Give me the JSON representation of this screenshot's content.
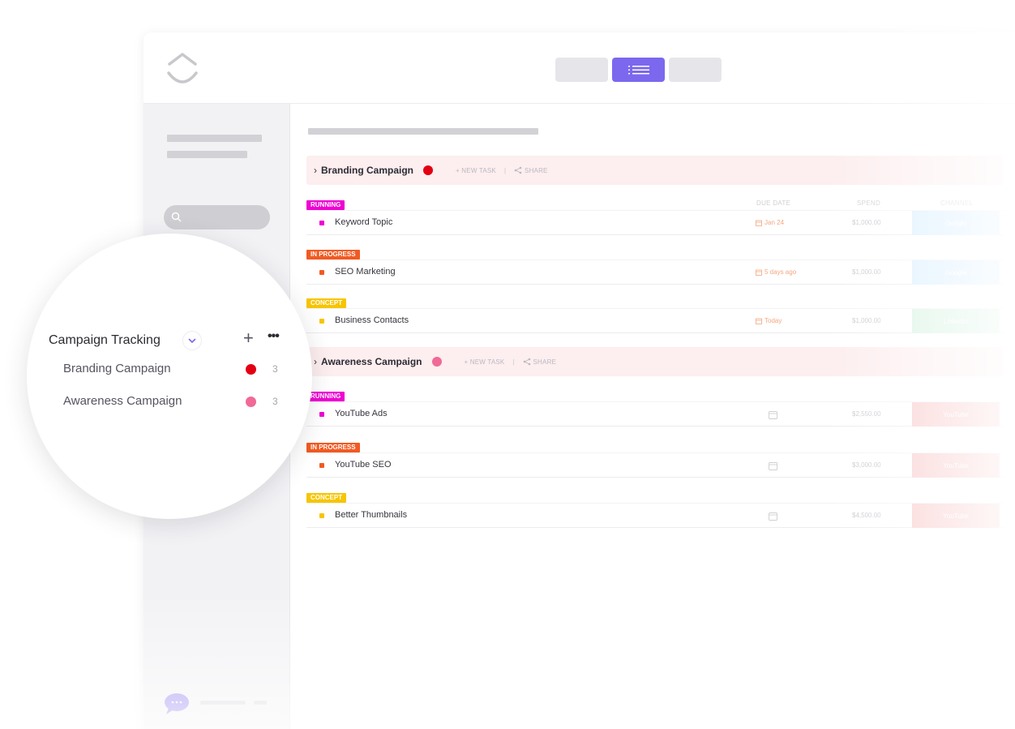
{
  "colors": {
    "accent": "#7b68ee",
    "running": "#ef00d3",
    "in_progress": "#f15a22",
    "concept": "#f7c500",
    "branding_dot": "#e20011",
    "awareness_dot": "#f06997",
    "google": "#d9efff",
    "linkedin": "#d7f3e2",
    "youtube": "#f9c9c9"
  },
  "columns": {
    "due_date": "DUE DATE",
    "spend": "SPEND",
    "channel": "CHANNEL"
  },
  "groups": [
    {
      "name": "Branding Campaign",
      "new_task": "+ NEW TASK",
      "separator": "|",
      "share": "SHARE",
      "tasks": [
        {
          "status": "RUNNING",
          "name": "Keyword Topic",
          "due": "Jan 24",
          "spend": "$1,000.00",
          "channel": "Google"
        },
        {
          "status": "IN PROGRESS",
          "name": "SEO Marketing",
          "due": "5 days ago",
          "spend": "$1,000.00",
          "channel": "Google"
        },
        {
          "status": "CONCEPT",
          "name": "Business Contacts",
          "due": "Today",
          "spend": "$1,000.00",
          "channel": "LinkedIn"
        }
      ]
    },
    {
      "name": "Awareness Campaign",
      "new_task": "+ NEW TASK",
      "separator": "|",
      "share": "SHARE",
      "tasks": [
        {
          "status": "RUNNING",
          "name": "YouTube Ads",
          "due": "",
          "spend": "$2,550.00",
          "channel": "YouTube"
        },
        {
          "status": "IN PROGRESS",
          "name": "YouTube SEO",
          "due": "",
          "spend": "$3,000.00",
          "channel": "YouTube"
        },
        {
          "status": "CONCEPT",
          "name": "Better Thumbnails",
          "due": "",
          "spend": "$4,500.00",
          "channel": "YouTube"
        }
      ]
    }
  ],
  "sidebar_zoom": {
    "title": "Campaign Tracking",
    "add": "+",
    "more": "•••",
    "items": [
      {
        "label": "Branding Campaign",
        "count": "3"
      },
      {
        "label": "Awareness Campaign",
        "count": "3"
      }
    ]
  },
  "icons": [
    "logo-icon",
    "list-view-icon",
    "search-icon",
    "chevron-right-icon",
    "share-icon",
    "calendar-icon",
    "chevron-down-icon",
    "plus-icon",
    "more-icon",
    "chat-icon"
  ]
}
